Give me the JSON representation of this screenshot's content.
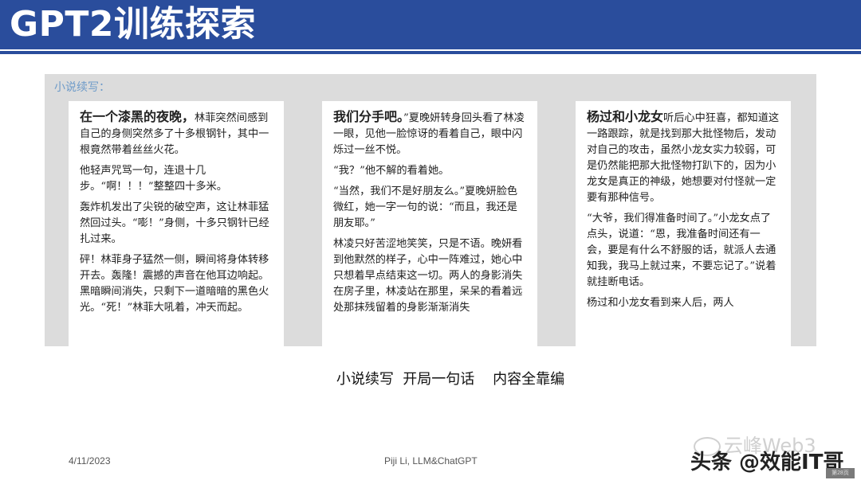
{
  "slide": {
    "title": "GPT2训练探索",
    "panel_label": "小说续写：",
    "columns": [
      {
        "lead": "在一个漆黑的夜晚，",
        "paragraphs": [
          "林菲突然间感到自己的身侧突然多了十多根钢针，其中一根竟然带着丝丝火花。",
          "他轻声咒骂一句，连退十几步。“啊！！！”整整四十多米。",
          "轰炸机发出了尖锐的破空声，这让林菲猛然回过头。“嘭！”身侧，十多只钢针已经扎过来。",
          "砰！林菲身子猛然一侧，瞬间将身体转移开去。轰隆！震撼的声音在他耳边响起。黑暗瞬间消失，只剩下一道暗暗的黑色火光。“死！”林菲大吼着，冲天而起。"
        ]
      },
      {
        "lead": "我们分手吧。",
        "paragraphs": [
          "”夏晚妍转身回头看了林凌一眼，见他一脸惊讶的看着自己，眼中闪烁过一丝不悦。",
          "“我？”他不解的看着她。",
          "“当然，我们不是好朋友么。”夏晚妍脸色微红，她一字一句的说：“而且，我还是朋友耶。”",
          "林凌只好苦涩地笑笑，只是不语。晚妍看到他默然的样子，心中一阵难过，她心中只想着早点结束这一切。两人的身影消失在房子里，林凌站在那里，呆呆的看着远处那抹残留着的身影渐渐消失"
        ]
      },
      {
        "lead": "杨过和小龙女",
        "paragraphs": [
          "听后心中狂喜，都知道这一路跟踪，就是找到那大批怪物后，发动对自己的攻击，虽然小龙女实力较弱，可是仍然能把那大批怪物打趴下的，因为小龙女是真正的神级，她想要对付怪就一定要有那种信号。",
          "“大爷，我们得准备时间了。”小龙女点了点头，说道：“恩，我准备时间还有一会，要是有什么不舒服的话，就派人去通知我，我马上就过来，不要忘记了。”说着就挂断电话。",
          "杨过和小龙女看到来人后，两人"
        ]
      }
    ],
    "caption": "小说续写  开局一句话    内容全靠编",
    "footer_date": "4/11/2023",
    "footer_center": "Piji Li, LLM&ChatGPT",
    "watermark_faint": "云峰Web3",
    "watermark": "头条 @效能IT哥",
    "page_chip": "第28页"
  },
  "colors": {
    "title_bar": "#2a4d9c",
    "panel_bg": "#dcdcdc",
    "panel_label": "#6e9bc9"
  }
}
